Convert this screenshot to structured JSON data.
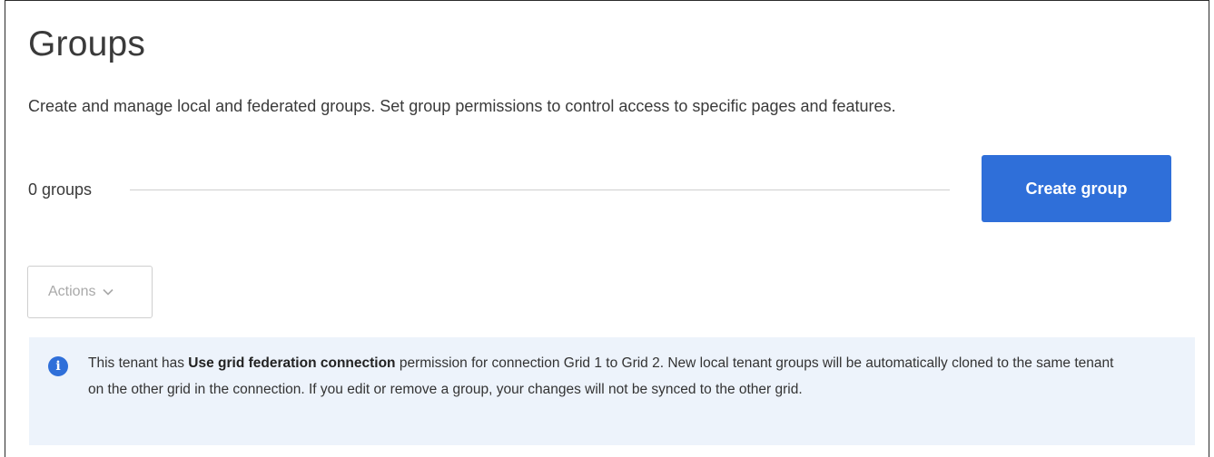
{
  "page": {
    "title": "Groups",
    "description": "Create and manage local and federated groups. Set group permissions to control access to specific pages and features."
  },
  "groups_summary": {
    "count_label": "0 groups"
  },
  "toolbar": {
    "create_label": "Create group",
    "actions_label": "Actions",
    "actions_enabled": false
  },
  "notice": {
    "icon": "info-icon",
    "text_before": "This tenant has ",
    "bold_text": "Use grid federation connection",
    "text_after": " permission for connection Grid 1 to Grid 2. New local tenant groups will be automatically cloned to the same tenant on the other grid in the connection. If you edit or remove a group, your changes will not be synced to the other grid."
  },
  "colors": {
    "primary": "#2f6fd9",
    "notice_background": "#edf3fb",
    "disabled_text": "#a9a9a9"
  }
}
